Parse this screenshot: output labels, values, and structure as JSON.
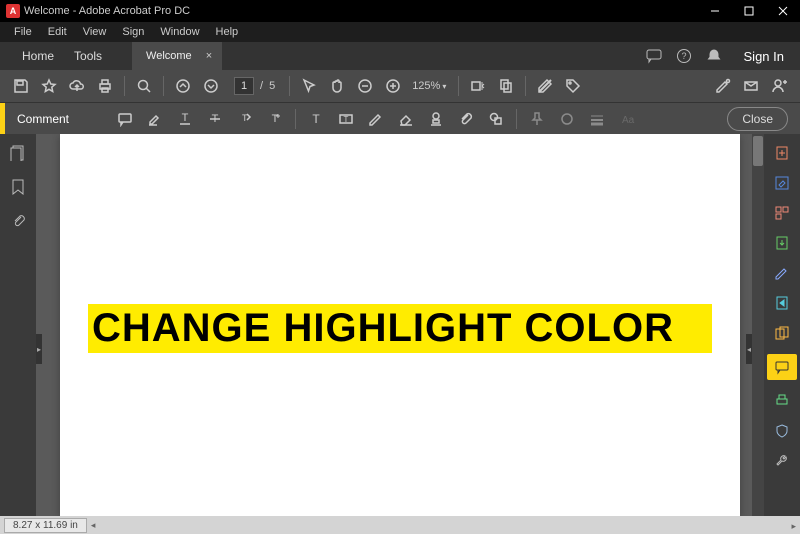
{
  "titlebar": {
    "title": "Welcome - Adobe Acrobat Pro DC"
  },
  "menu": {
    "file": "File",
    "edit": "Edit",
    "view": "View",
    "sign": "Sign",
    "window": "Window",
    "help": "Help"
  },
  "nav": {
    "home": "Home",
    "tools": "Tools",
    "tab": "Welcome"
  },
  "signin": "Sign In",
  "page": {
    "current": "1",
    "sep": "/",
    "total": "5"
  },
  "zoom": {
    "value": "125%"
  },
  "comment": {
    "label": "Comment",
    "close": "Close"
  },
  "doc": {
    "highlight_text": "CHANGE HIGHLIGHT COLOR"
  },
  "status": {
    "pagesize": "8.27 x 11.69 in"
  },
  "colors": {
    "highlight": "#ffec00",
    "accent": "#fcd116"
  }
}
